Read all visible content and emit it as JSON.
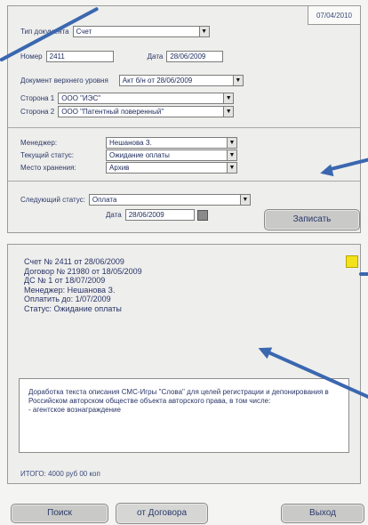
{
  "header": {
    "date": "07/04/2010"
  },
  "document": {
    "type_label": "Тип документа",
    "type_value": "Счет",
    "number_label": "Номер",
    "number_value": "2411",
    "date_label": "Дата",
    "date_value": "28/06/2009",
    "parent_label": "Документ верхнего уровня",
    "parent_value": "Акт б/н от 28/06/2009",
    "side1_label": "Сторона 1",
    "side1_value": "ООО \"ИЭС\"",
    "side2_label": "Сторона 2",
    "side2_value": "ООО \"Патентный поверенный\""
  },
  "status": {
    "manager_label": "Менеджер:",
    "manager_value": "Нешанова З.",
    "current_label": "Текущий статус:",
    "current_value": "Ожидание оплаты",
    "storage_label": "Место хранения:",
    "storage_value": "Архив"
  },
  "next": {
    "label": "Следующий статус:",
    "value": "Оплата",
    "date_label": "Дата",
    "date_value": "28/06/2009",
    "save_button": "Записать"
  },
  "summary": {
    "lines": [
      "Счет № 2411 от 28/06/2009",
      "Договор № 21980 от 18/05/2009",
      "ДС № 1 от 18/07/2009",
      "Менеджер: Нешанова З.",
      "Оплатить до: 1/07/2009",
      "Статус: Ожидание оплаты"
    ],
    "notes": "Доработка текста описания СМС-Игры \"Слова\" для целей регистрации и депонирования в Российском авторском обществе объекта авторского права, в том числе:\n- агентское вознаграждение",
    "total": "ИТОГО:  4000 руб 00 коп"
  },
  "footer": {
    "search_button": "Поиск",
    "contract_button": "от Договора",
    "exit_button": "Выход"
  },
  "colors": {
    "accent": "#3b67b0",
    "flag": "#f3e21a",
    "button": "#c9c9c7"
  }
}
